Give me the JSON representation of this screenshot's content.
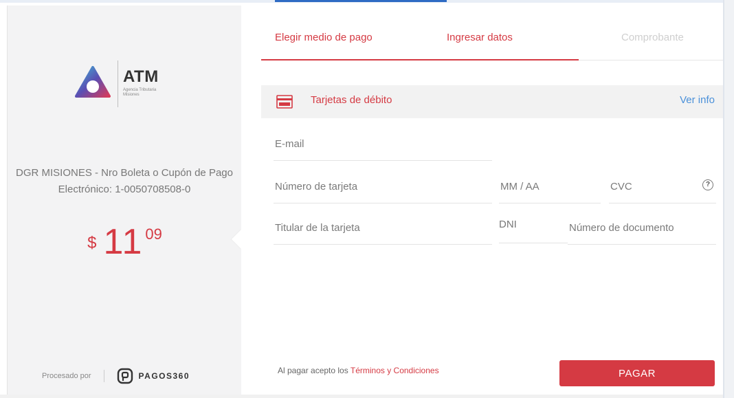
{
  "brand": {
    "name": "ATM",
    "subtitle": "Agencia Tributaria Misiones"
  },
  "order": {
    "description": "DGR MISIONES - Nro Boleta o Cupón de Pago Electrónico: 1-0050708508-0",
    "currency": "$",
    "amount_int": "11",
    "amount_dec": "09"
  },
  "footer_left": {
    "processed_by": "Procesado por",
    "processor_brand": "PAGOS360"
  },
  "steps": [
    {
      "label": "Elegir medio de pago",
      "state": "done"
    },
    {
      "label": "Ingresar datos",
      "state": "active"
    },
    {
      "label": "Comprobante",
      "state": "pending"
    }
  ],
  "payment_method": {
    "label": "Tarjetas de débito",
    "info_link": "Ver info",
    "icon": "debit-card-icon"
  },
  "form": {
    "email_placeholder": "E-mail",
    "card_number_placeholder": "Número de tarjeta",
    "expiry_placeholder": "MM / AA",
    "cvc_placeholder": "CVC",
    "cvc_help": "?",
    "holder_placeholder": "Titular de la tarjeta",
    "doc_type": "DNI",
    "doc_number_placeholder": "Número de documento"
  },
  "terms": {
    "prefix": "Al pagar acepto los ",
    "link": "Términos y Condiciones"
  },
  "pay_button": "PAGAR",
  "colors": {
    "accent": "#d53a43",
    "link": "#4a90d9",
    "sidebar_bg": "#f3f3f4"
  }
}
